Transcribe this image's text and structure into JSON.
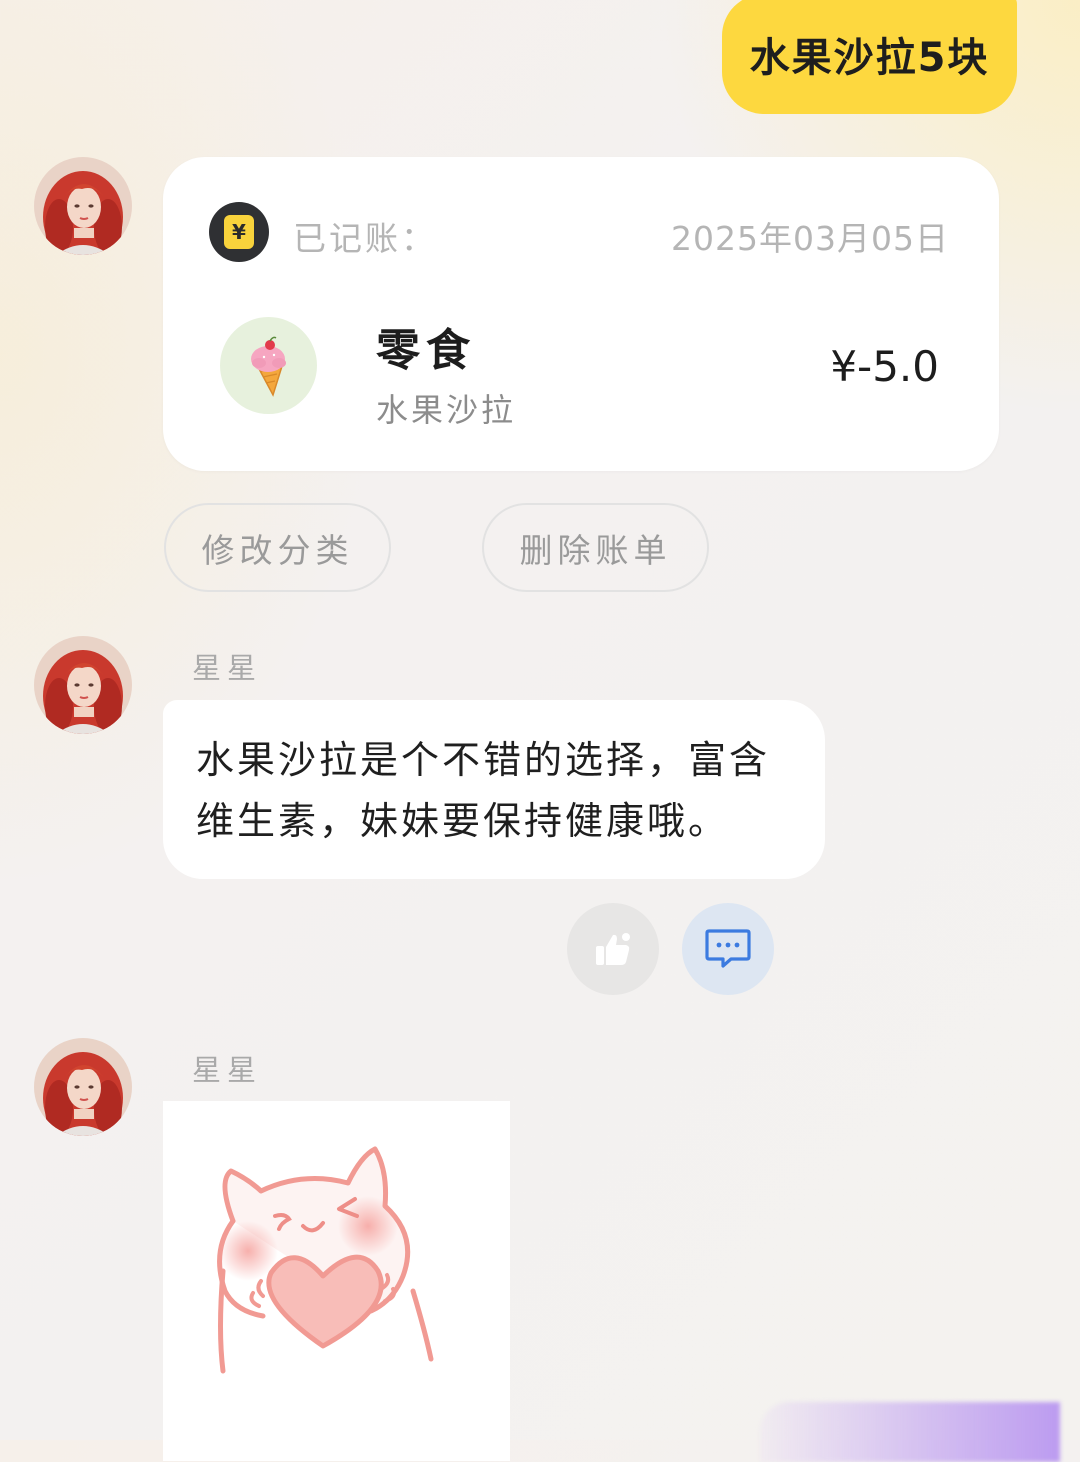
{
  "user_message": {
    "text": "水果沙拉5块"
  },
  "record_card": {
    "badge_symbol": "¥",
    "label": "已记账：",
    "date": "2025年03月05日",
    "category_icon": "ice-cream-icon",
    "category": "零食",
    "note": "水果沙拉",
    "amount": "¥-5.0"
  },
  "actions": {
    "edit_category": "修改分类",
    "delete_bill": "删除账单"
  },
  "reply": {
    "sender": "星星",
    "text_line1": "水果沙拉是个不错的选择，富含",
    "text_line2": "维生素，妹妹要保持健康哦。"
  },
  "reply_actions": {
    "like_icon": "thumbs-up-icon",
    "comment_icon": "message-icon"
  },
  "sticker_message": {
    "sender": "星星",
    "sticker": "cat-holding-heart-sticker"
  },
  "colors": {
    "user_bubble": "#fdd83f",
    "card_bg": "#ffffff",
    "category_icon_bg": "#e7f1dd",
    "comment_btn_bg": "#dde6f2",
    "comment_icon": "#3c7be0"
  }
}
